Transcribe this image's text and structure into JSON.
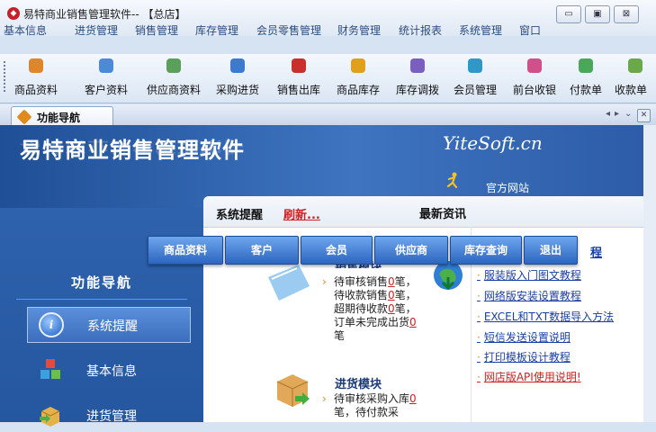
{
  "window": {
    "title": "易特商业销售管理软件-- 【总店】",
    "app_icon": "app-logo-icon",
    "controls": {
      "minimize": "▭",
      "maximize": "▣",
      "close": "⊠"
    }
  },
  "menu": [
    "基本信息",
    "进货管理",
    "销售管理",
    "库存管理",
    "会员零售管理",
    "财务管理",
    "统计报表",
    "系统管理",
    "窗口"
  ],
  "toolbar": [
    {
      "label": "商品资料",
      "icon": "goods-icon",
      "color": "#e0862a"
    },
    {
      "label": "客户资料",
      "icon": "customers-icon",
      "color": "#4a8ad6"
    },
    {
      "label": "供应商资料",
      "icon": "supplier-icon",
      "color": "#5aa05a"
    },
    {
      "label": "采购进货",
      "icon": "purchase-icon",
      "color": "#3c7ad0"
    },
    {
      "label": "销售出库",
      "icon": "sales-out-icon",
      "color": "#c8302c"
    },
    {
      "label": "商品库存",
      "icon": "inventory-icon",
      "color": "#e0a01c"
    },
    {
      "label": "库存调拨",
      "icon": "transfer-icon",
      "color": "#7a5fc0"
    },
    {
      "label": "会员管理",
      "icon": "member-icon",
      "color": "#2f98c8"
    },
    {
      "label": "前台收银",
      "icon": "cashier-icon",
      "color": "#d0508c"
    },
    {
      "label": "付款单",
      "icon": "payment-icon",
      "color": "#4aa85a"
    },
    {
      "label": "收款单",
      "icon": "receipt-icon",
      "color": "#6aa84a"
    }
  ],
  "tabs": {
    "active_label": "功能导航"
  },
  "banner": {
    "brand_cn": "易特商业销售管理软件",
    "brand_en": "YiteSoft.cn",
    "site_link": "官方网站"
  },
  "sidebar": {
    "title": "功能导航",
    "items": [
      {
        "label": "系统提醒",
        "icon": "info-icon",
        "active": true
      },
      {
        "label": "基本信息",
        "icon": "cubes-icon",
        "active": false
      },
      {
        "label": "进货管理",
        "icon": "purchase-box-icon",
        "active": false
      }
    ]
  },
  "content": {
    "reminder_label": "系统提醒",
    "refresh_label": "刷新...",
    "news_label": "最新资讯"
  },
  "quickbar": [
    "商品资料",
    "客户",
    "会员",
    "供应商",
    "库存查询",
    "退出"
  ],
  "quickbar_tail": "程",
  "modules": {
    "sales": {
      "title": "销售模块",
      "line1": "待审核销售",
      "n1": "0",
      "line2": "笔，待收款销售",
      "n2": "0",
      "line3": "笔，超期待收款",
      "n3": "0",
      "line4": "笔，订单未完成出货",
      "n4": "0",
      "line5": "笔"
    },
    "purchase": {
      "title": "进货模块",
      "line1": "待审核采购入库",
      "n1": "0",
      "line2": "笔，待付款采"
    }
  },
  "news": [
    {
      "text": "服装版入门图文教程",
      "red": false
    },
    {
      "text": "网络版安装设置教程",
      "red": false
    },
    {
      "text": "EXCEL和TXT数据导入方法",
      "red": false
    },
    {
      "text": "短信发送设置说明",
      "red": false
    },
    {
      "text": "打印模板设计教程",
      "red": false
    },
    {
      "text": "网店版API使用说明!",
      "red": true
    }
  ]
}
